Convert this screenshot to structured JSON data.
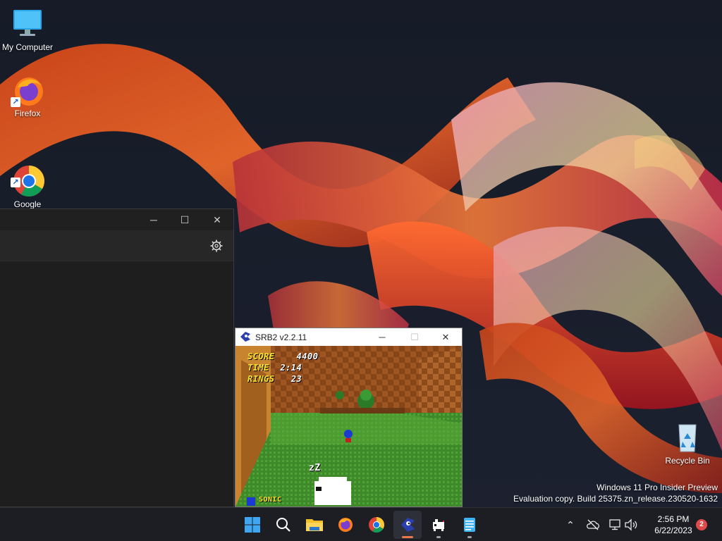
{
  "desktop": {
    "icons": [
      {
        "label": "My Computer"
      },
      {
        "label": "Firefox"
      },
      {
        "label": "Google\nChrome"
      },
      {
        "label": "Recycle Bin"
      }
    ],
    "shortcut_arrow": "↗"
  },
  "settings_window": {
    "controls": {
      "minimize": "─",
      "maximize": "☐",
      "close": "✕"
    }
  },
  "srb2_window": {
    "title": "SRB2 v2.2.11",
    "controls": {
      "minimize": "─",
      "maximize": "☐",
      "close": "✕"
    },
    "hud": {
      "score_label": "SCORE",
      "score_value": "4400",
      "time_label": "TIME",
      "time_value": "2:14",
      "rings_label": "RINGS",
      "rings_value": "23",
      "character_label": "SONIC",
      "sleep_text": "zZ"
    }
  },
  "watermark": {
    "line1": "Windows 11 Pro Insider Preview",
    "line2": "Evaluation copy. Build 25375.zn_release.230520-1632"
  },
  "taskbar": {
    "apps": [
      "start-icon",
      "search-icon",
      "file-explorer-icon",
      "firefox-icon",
      "chrome-icon",
      "srb2-icon",
      "paint-icon",
      "notepad-icon"
    ],
    "tray": {
      "chevron": "⌃"
    },
    "clock": {
      "time": "2:56 PM",
      "date": "6/22/2023"
    },
    "notifications": "2"
  },
  "colors": {
    "accent_orange": "#e8774a",
    "taskbar_bg": "#1c1e24",
    "hud_yellow": "#f8e030"
  }
}
